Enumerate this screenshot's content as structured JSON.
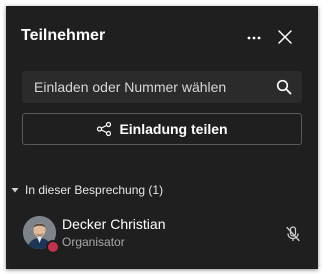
{
  "panel": {
    "title": "Teilnehmer",
    "more_icon": "more-horizontal-icon",
    "close_icon": "close-icon"
  },
  "search": {
    "placeholder": "Einladen oder Nummer wählen",
    "icon": "search-icon"
  },
  "share": {
    "label": "Einladung teilen",
    "icon": "share-icon"
  },
  "section": {
    "label": "In dieser Besprechung (1)",
    "icon": "chevron-down-icon"
  },
  "participants": [
    {
      "name": "Decker Christian",
      "role": "Organisator",
      "status_color": "#c4314b",
      "mic_icon": "mic-muted-icon"
    }
  ],
  "colors": {
    "panel_bg": "#1f1f1f",
    "input_bg": "#2b2b2b",
    "text": "#ffffff",
    "muted_text": "#a8a8a8"
  }
}
